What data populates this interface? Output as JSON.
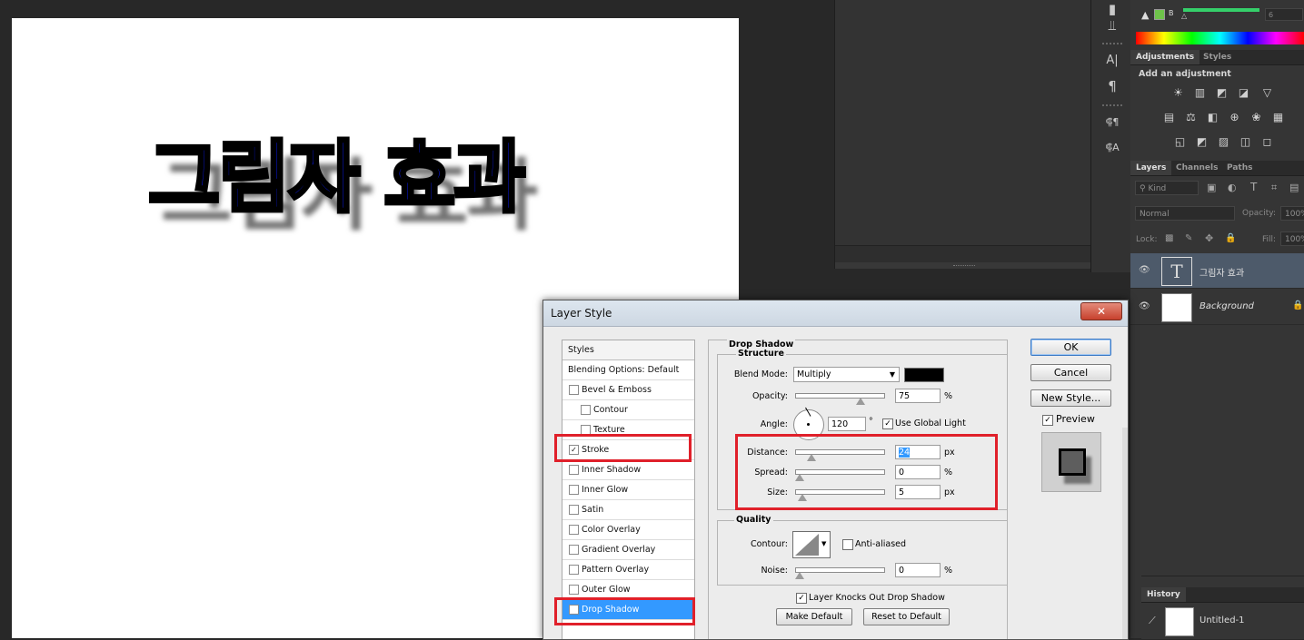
{
  "canvas": {
    "art_text": "그림자 효과",
    "text_color": "#0a1aff"
  },
  "toolstrip": {
    "icons": [
      "toolbar-grip-icon",
      "sliders-icon",
      "character-icon",
      "paragraph-icon",
      "character-styles-icon",
      "paragraph-styles-icon"
    ],
    "glyphs": [
      "▮",
      "⫫",
      "A|",
      "¶",
      "⸿¶",
      "⸿A"
    ]
  },
  "color_panel": {
    "label_b": "B",
    "value": "6"
  },
  "adjustments": {
    "tabs": [
      "Adjustments",
      "Styles"
    ],
    "heading": "Add an adjustment",
    "row1": [
      "☀",
      "▥",
      "◩",
      "◪",
      "▽"
    ],
    "row2": [
      "▤",
      "⚖",
      "◧",
      "⊕",
      "❀",
      "▦"
    ],
    "row3": [
      "◱",
      "◩",
      "▨",
      "◫",
      "◻"
    ]
  },
  "layers": {
    "tabs": [
      "Layers",
      "Channels",
      "Paths"
    ],
    "filter_kind": "Kind",
    "blend_mode": "Normal",
    "opacity_label": "Opacity:",
    "opacity_value": "100%",
    "lock_label": "Lock:",
    "fill_label": "Fill:",
    "fill_value": "100%",
    "items": [
      {
        "name": "그림자 효과",
        "thumb": "T"
      },
      {
        "name": "Background"
      }
    ]
  },
  "history": {
    "tab": "History",
    "item": "Untitled-1"
  },
  "dialog": {
    "title": "Layer Style",
    "close": "✕",
    "styles": [
      {
        "label": "Styles",
        "check": false,
        "indent": 6,
        "checked": false
      },
      {
        "label": "Blending Options: Default",
        "check": false,
        "indent": 6,
        "checked": false
      },
      {
        "label": "Bevel & Emboss",
        "check": true,
        "indent": 21,
        "checked": false
      },
      {
        "label": "Contour",
        "check": true,
        "indent": 34,
        "checked": false
      },
      {
        "label": "Texture",
        "check": true,
        "indent": 34,
        "checked": false
      },
      {
        "label": "Stroke",
        "check": true,
        "indent": 21,
        "checked": true
      },
      {
        "label": "Inner Shadow",
        "check": true,
        "indent": 21,
        "checked": false
      },
      {
        "label": "Inner Glow",
        "check": true,
        "indent": 21,
        "checked": false
      },
      {
        "label": "Satin",
        "check": true,
        "indent": 21,
        "checked": false
      },
      {
        "label": "Color Overlay",
        "check": true,
        "indent": 21,
        "checked": false
      },
      {
        "label": "Gradient Overlay",
        "check": true,
        "indent": 21,
        "checked": false
      },
      {
        "label": "Pattern Overlay",
        "check": true,
        "indent": 21,
        "checked": false
      },
      {
        "label": "Outer Glow",
        "check": true,
        "indent": 21,
        "checked": false
      },
      {
        "label": "Drop Shadow",
        "check": true,
        "indent": 21,
        "checked": true,
        "selected": true
      }
    ],
    "drop_shadow": "Drop Shadow",
    "structure": "Structure",
    "blend_mode_label": "Blend Mode:",
    "blend_mode_value": "Multiply",
    "shadow_color": "#000000",
    "opacity_label": "Opacity:",
    "opacity_value": "75",
    "angle_label": "Angle:",
    "angle_value": "120",
    "degree": "°",
    "use_global_light": "Use Global Light",
    "distance_label": "Distance:",
    "distance_value": "24",
    "spread_label": "Spread:",
    "spread_value": "0",
    "size_label": "Size:",
    "size_value": "5",
    "px": "px",
    "pct": "%",
    "quality": "Quality",
    "contour_label": "Contour:",
    "anti_aliased": "Anti-aliased",
    "noise_label": "Noise:",
    "noise_value": "0",
    "knocks_out": "Layer Knocks Out Drop Shadow",
    "make_default": "Make Default",
    "reset_default": "Reset to Default",
    "ok": "OK",
    "cancel": "Cancel",
    "new_style": "New Style...",
    "preview": "Preview",
    "levels": {
      "opacity": 0.75,
      "distance": 0.15,
      "spread": 0.0,
      "size": 0.03,
      "noise": 0.0
    },
    "highlight_color": "#e0202a"
  }
}
